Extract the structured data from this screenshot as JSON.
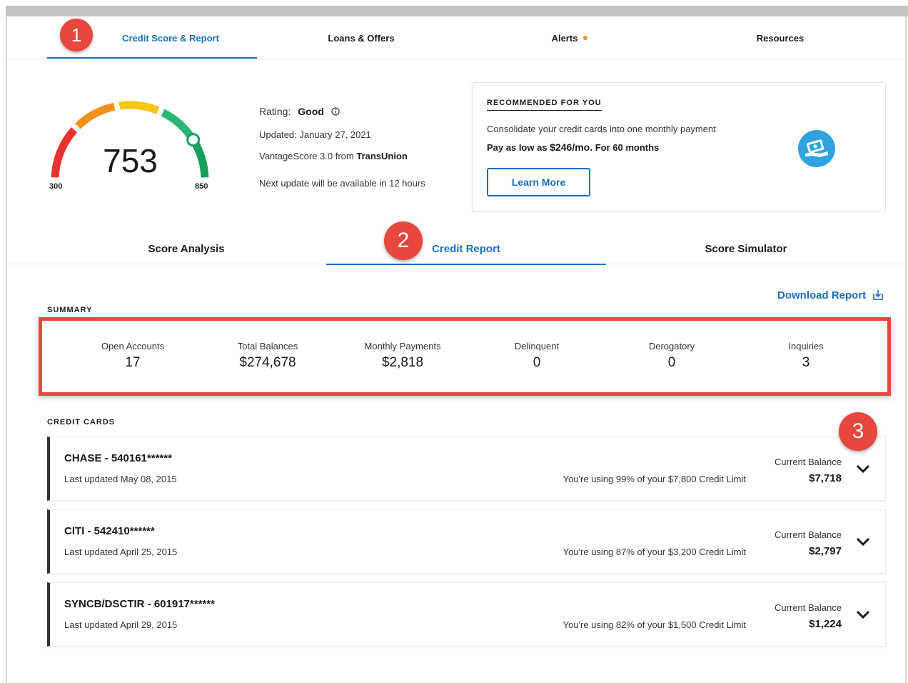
{
  "top_nav": {
    "tabs": [
      {
        "label": "Credit Score & Report"
      },
      {
        "label": "Loans & Offers"
      },
      {
        "label": "Alerts"
      },
      {
        "label": "Resources"
      }
    ]
  },
  "badges": [
    "1",
    "2",
    "3"
  ],
  "score": {
    "value": "753",
    "min": "300",
    "max": "850",
    "gauge_position_fraction": 0.82,
    "rating_label": "Rating:",
    "rating": "Good",
    "updated": "Updated: January 27, 2021",
    "source_prefix": "VantageScore 3.0 from ",
    "source_bureau": "TransUnion",
    "next_update": "Next update will be available in 12 hours"
  },
  "recommended": {
    "heading": "RECOMMENDED FOR YOU",
    "text": "Consolidate your credit cards into one monthly payment",
    "offer_prefix": "Pay as low as ",
    "offer_amount": "$246/mo.",
    "offer_suffix": " For 60 months",
    "button": "Learn More"
  },
  "sub_nav": {
    "tabs": [
      {
        "label": "Score Analysis"
      },
      {
        "label": "Credit Report"
      },
      {
        "label": "Score Simulator"
      }
    ]
  },
  "download_label": "Download Report",
  "summary": {
    "label": "SUMMARY",
    "items": [
      {
        "label": "Open Accounts",
        "value": "17"
      },
      {
        "label": "Total Balances",
        "value": "$274,678"
      },
      {
        "label": "Monthly Payments",
        "value": "$2,818"
      },
      {
        "label": "Delinquent",
        "value": "0"
      },
      {
        "label": "Derogatory",
        "value": "0"
      },
      {
        "label": "Inquiries",
        "value": "3"
      }
    ]
  },
  "credit_cards": {
    "label": "CREDIT CARDS",
    "balance_label": "Current Balance",
    "accounts": [
      {
        "name": "CHASE - 540161******",
        "updated": "Last updated May 08, 2015",
        "usage": "You're using 99% of your $7,800 Credit Limit",
        "balance": "$7,718"
      },
      {
        "name": "CITI - 542410******",
        "updated": "Last updated April 25, 2015",
        "usage": "You're using 87% of your $3,200 Credit Limit",
        "balance": "$2,797"
      },
      {
        "name": "SYNCB/DSCTIR - 601917******",
        "updated": "Last updated April 29, 2015",
        "usage": "You're using 82% of your $1,500 Credit Limit",
        "balance": "$1,224"
      }
    ]
  },
  "colors": {
    "brand_blue": "#1a6fbf",
    "highlight_red": "#e8473d",
    "alert_dot": "#f39019",
    "gauge_red": "#e8332c",
    "gauge_orange": "#f39019",
    "gauge_yellow": "#f5c518",
    "gauge_green": "#16a05b"
  }
}
